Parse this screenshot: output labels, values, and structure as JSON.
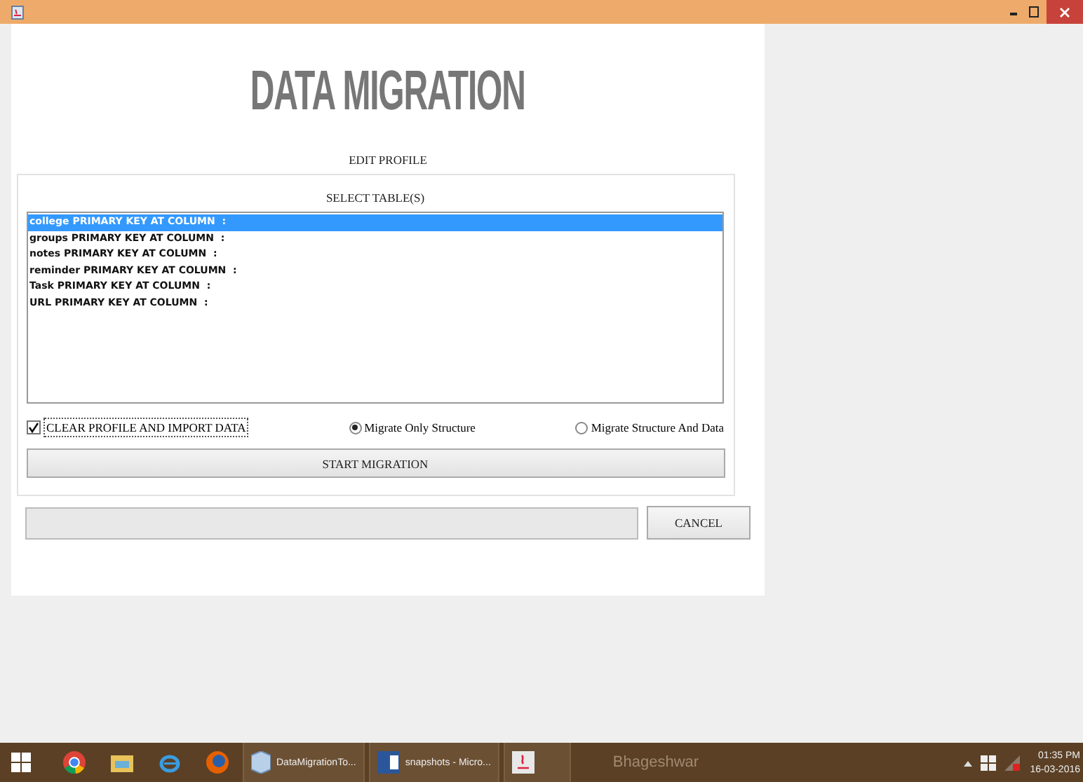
{
  "heading": "DATA MIGRATION",
  "subheading": "EDIT PROFILE",
  "panel": {
    "label": "SELECT TABLE(S)",
    "tables": [
      {
        "name": "college PRIMARY KEY AT COLUMN  :",
        "selected": true
      },
      {
        "name": "groups PRIMARY KEY AT COLUMN  :",
        "selected": false
      },
      {
        "name": "notes PRIMARY KEY AT COLUMN  :",
        "selected": false
      },
      {
        "name": "reminder PRIMARY KEY AT COLUMN  :",
        "selected": false
      },
      {
        "name": "Task PRIMARY KEY AT COLUMN  :",
        "selected": false
      },
      {
        "name": "URL PRIMARY KEY AT COLUMN  :",
        "selected": false
      }
    ],
    "clear_option": {
      "label": "CLEAR PROFILE AND IMPORT DATA",
      "checked": true
    },
    "modes": [
      {
        "label": "Migrate Only Structure",
        "selected": true
      },
      {
        "label": "Migrate Structure And Data",
        "selected": false
      }
    ],
    "start_button": "START MIGRATION"
  },
  "cancel_button": "CANCEL",
  "taskbar": {
    "tasks": [
      {
        "kind": "app",
        "label": "DataMigrationTo..."
      },
      {
        "kind": "word",
        "label": "snapshots - Micro..."
      },
      {
        "kind": "java"
      }
    ],
    "location": "Bhageshwar",
    "time": "01:35 PM",
    "date": "16-03-2016"
  }
}
